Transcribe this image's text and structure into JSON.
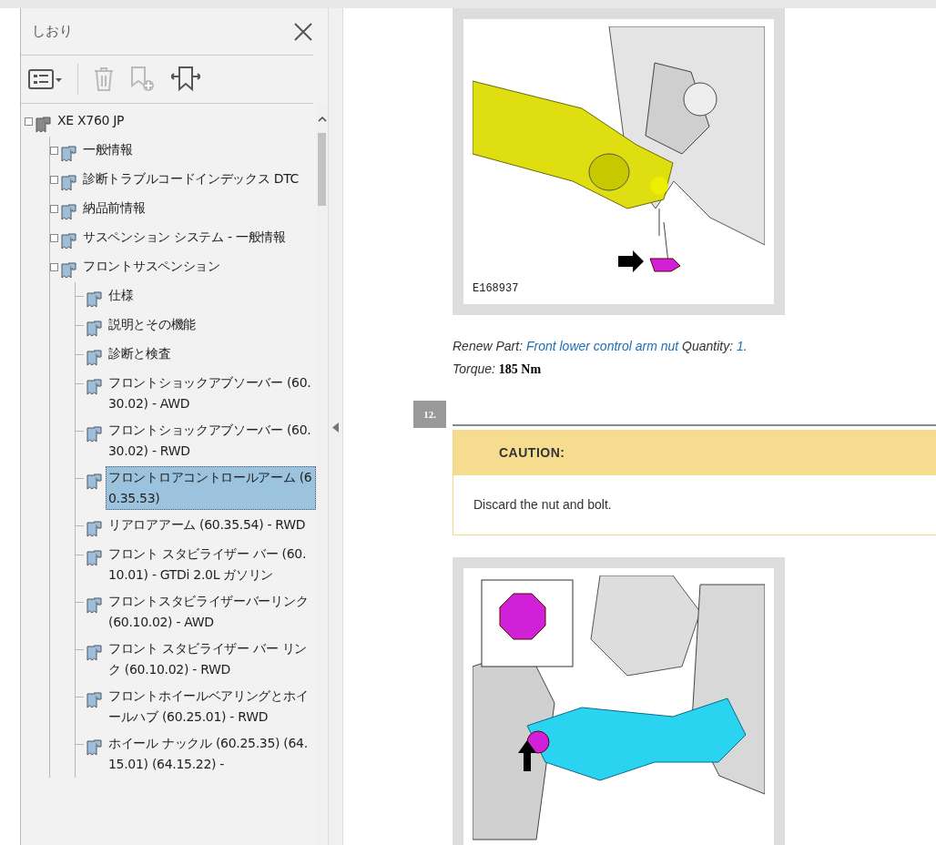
{
  "sidebar": {
    "title": "しおり",
    "tree": [
      {
        "label": "XE X760 JP",
        "expandable": true,
        "selected": false,
        "children": [
          {
            "label": "一般情報",
            "expandable": true,
            "selected": false
          },
          {
            "label": "診断トラブルコードインデックス DTC",
            "expandable": true,
            "selected": false
          },
          {
            "label": "納品前情報",
            "expandable": true,
            "selected": false
          },
          {
            "label": "サスペンション システム - 一般情報",
            "expandable": true,
            "selected": false
          },
          {
            "label": "フロントサスペンション",
            "expandable": true,
            "selected": false,
            "children": [
              {
                "label": "仕様",
                "expandable": false,
                "selected": false
              },
              {
                "label": "説明とその機能",
                "expandable": false,
                "selected": false
              },
              {
                "label": "診断と検査",
                "expandable": false,
                "selected": false
              },
              {
                "label": "フロントショックアブソーバー (60.30.02) - AWD",
                "expandable": false,
                "selected": false
              },
              {
                "label": "フロントショックアブソーバー (60.30.02) - RWD",
                "expandable": false,
                "selected": false
              },
              {
                "label": "フロントロアコントロールアーム (60.35.53)",
                "expandable": false,
                "selected": true
              },
              {
                "label": "リアロアアーム (60.35.54) - RWD",
                "expandable": false,
                "selected": false
              },
              {
                "label": "フロント スタビライザー バー (60.10.01) - GTDi 2.0L ガソリン",
                "expandable": false,
                "selected": false
              },
              {
                "label": "フロントスタビライザーバーリンク (60.10.02) - AWD",
                "expandable": false,
                "selected": false
              },
              {
                "label": "フロント スタビライザー バー リンク (60.10.02) - RWD",
                "expandable": false,
                "selected": false
              },
              {
                "label": "フロントホイールベアリングとホイールハブ (60.25.01) - RWD",
                "expandable": false,
                "selected": false
              },
              {
                "label": "ホイール ナックル (60.25.35) (64.15.01) (64.15.22) -",
                "expandable": false,
                "selected": false
              }
            ]
          }
        ]
      }
    ]
  },
  "document": {
    "figure_caption": "E168937",
    "renew_part": {
      "label": "Renew Part:",
      "part": "Front lower control arm nut",
      "quantity_label": "Quantity:",
      "quantity": "1",
      "suffix": "."
    },
    "torque": {
      "label": "Torque:",
      "value": "185 Nm"
    },
    "step": "12.",
    "caution": {
      "title": "CAUTION:",
      "text": "Discard the nut and bolt."
    }
  }
}
